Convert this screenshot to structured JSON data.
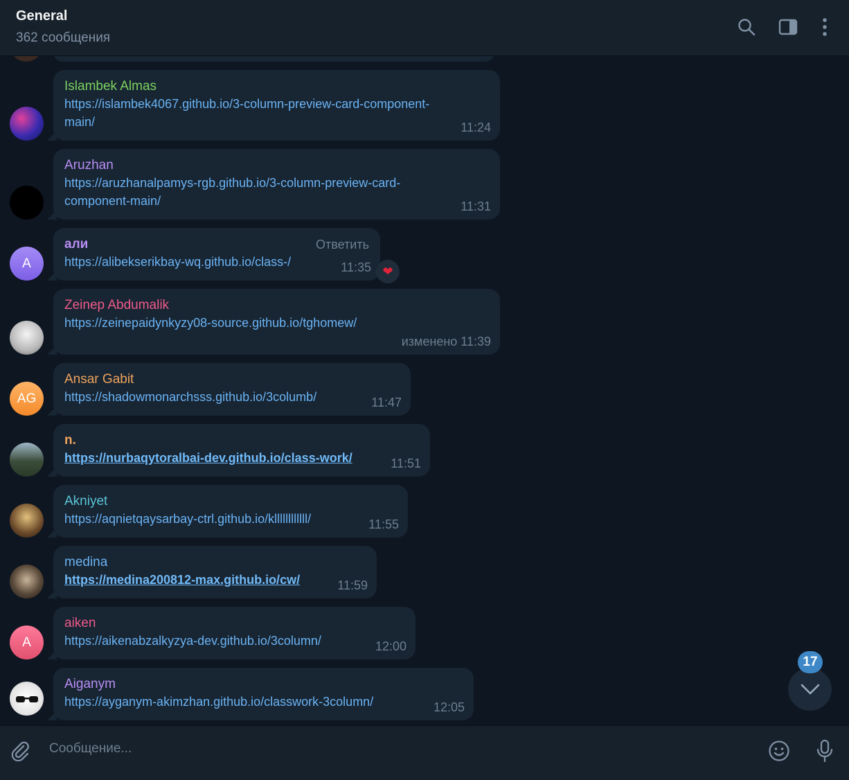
{
  "header": {
    "title": "General",
    "subtitle": "362 сообщения",
    "icons": [
      "search-icon",
      "sidebar-toggle-icon",
      "more-vertical-icon"
    ]
  },
  "messages": [
    {
      "sender": "Islambek Almas",
      "sender_color": "#7bd25e",
      "link": "https://islambek4067.github.io/3-column-preview-card-component-main/",
      "link_line1": "https://islambek4067.github.io/3-column-preview-card-component-",
      "link_line2": "main/",
      "time": "11:24"
    },
    {
      "sender": "Aruzhan",
      "sender_color": "#b98ff5",
      "link_line1": "https://aruzhanalpamys-rgb.github.io/3-column-preview-card-",
      "link_line2": "component-main/",
      "time": "11:31"
    },
    {
      "sender": "али",
      "sender_color": "#b98ff5",
      "avatar_initials": "A",
      "link": "https://alibekserikbay-wq.github.io/class-/",
      "time": "11:35",
      "reply_label": "Ответить",
      "reaction": "❤"
    },
    {
      "sender": "Zeinep Abdumalik",
      "sender_color": "#ee5a8a",
      "link": "https://zeinepaidynkyzy08-source.github.io/tghomew/",
      "time": "изменено 11:39"
    },
    {
      "sender": "Ansar Gabit",
      "sender_color": "#f0a45c",
      "avatar_initials": "AG",
      "link": "https://shadowmonarchsss.github.io/3columb/",
      "time": "11:47"
    },
    {
      "sender": "n.",
      "sender_color": "#f0a45c",
      "link": "https://nurbaqytoralbai-dev.github.io/class-work/",
      "time": "11:51"
    },
    {
      "sender": "Akniyet",
      "sender_color": "#5bc5d8",
      "link": "https://aqnietqaysarbay-ctrl.github.io/kllllllllllll/",
      "time": "11:55"
    },
    {
      "sender": "medina",
      "sender_color": "#6ab3f3",
      "link": "https://medina200812-max.github.io/cw/",
      "time": "11:59"
    },
    {
      "sender": "aiken",
      "sender_color": "#ee5a8a",
      "avatar_initials": "A",
      "link": "https://aikenabzalkyzya-dev.github.io/3column/",
      "time": "12:00"
    },
    {
      "sender": "Aiganym",
      "sender_color": "#b98ff5",
      "link": "https://ayganym-akimzhan.github.io/classwork-3column/",
      "time": "12:05"
    }
  ],
  "scroll": {
    "unread_count": "17"
  },
  "composer": {
    "placeholder": "Сообщение..."
  }
}
